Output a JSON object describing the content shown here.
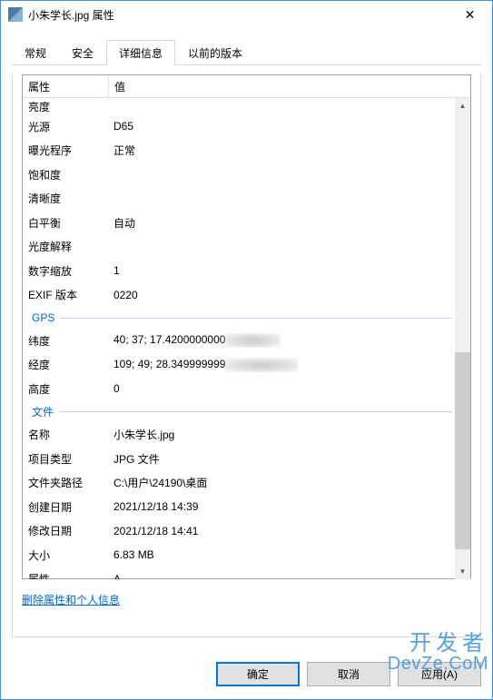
{
  "title": "小朱学长.jpg 属性",
  "tabs": {
    "general": "常规",
    "security": "安全",
    "details": "详细信息",
    "previous": "以前的版本"
  },
  "header": {
    "property": "属性",
    "value": "值"
  },
  "rows": {
    "brightness": {
      "label": "亮度",
      "value": ""
    },
    "light_source": {
      "label": "光源",
      "value": "D65"
    },
    "exposure_program": {
      "label": "曝光程序",
      "value": "正常"
    },
    "saturation": {
      "label": "饱和度",
      "value": ""
    },
    "sharpness": {
      "label": "清晰度",
      "value": ""
    },
    "white_balance": {
      "label": "白平衡",
      "value": "自动"
    },
    "metering_interp": {
      "label": "光度解释",
      "value": ""
    },
    "digital_zoom": {
      "label": "数字缩放",
      "value": "1"
    },
    "exif_version": {
      "label": "EXIF 版本",
      "value": "0220"
    }
  },
  "groups": {
    "gps": "GPS",
    "file": "文件"
  },
  "gps": {
    "latitude": {
      "label": "纬度",
      "value": "40; 37; 17.4200000000"
    },
    "longitude": {
      "label": "经度",
      "value": "109; 49; 28.349999999"
    },
    "altitude": {
      "label": "高度",
      "value": "0"
    }
  },
  "file": {
    "name": {
      "label": "名称",
      "value": "小朱学长.jpg"
    },
    "item_type": {
      "label": "项目类型",
      "value": "JPG 文件"
    },
    "folder_path": {
      "label": "文件夹路径",
      "value": "C:\\用户\\24190\\桌面"
    },
    "date_created": {
      "label": "创建日期",
      "value": "2021/12/18 14:39"
    },
    "date_modified": {
      "label": "修改日期",
      "value": "2021/12/18 14:41"
    },
    "size": {
      "label": "大小",
      "value": "6.83 MB"
    },
    "attributes": {
      "label": "属性",
      "value": "A"
    }
  },
  "remove_link": "删除属性和个人信息",
  "buttons": {
    "ok": "确定",
    "cancel": "取消",
    "apply": "应用(A)"
  },
  "watermark": {
    "line1": "开发者",
    "line2": "DevZe.CoM"
  }
}
